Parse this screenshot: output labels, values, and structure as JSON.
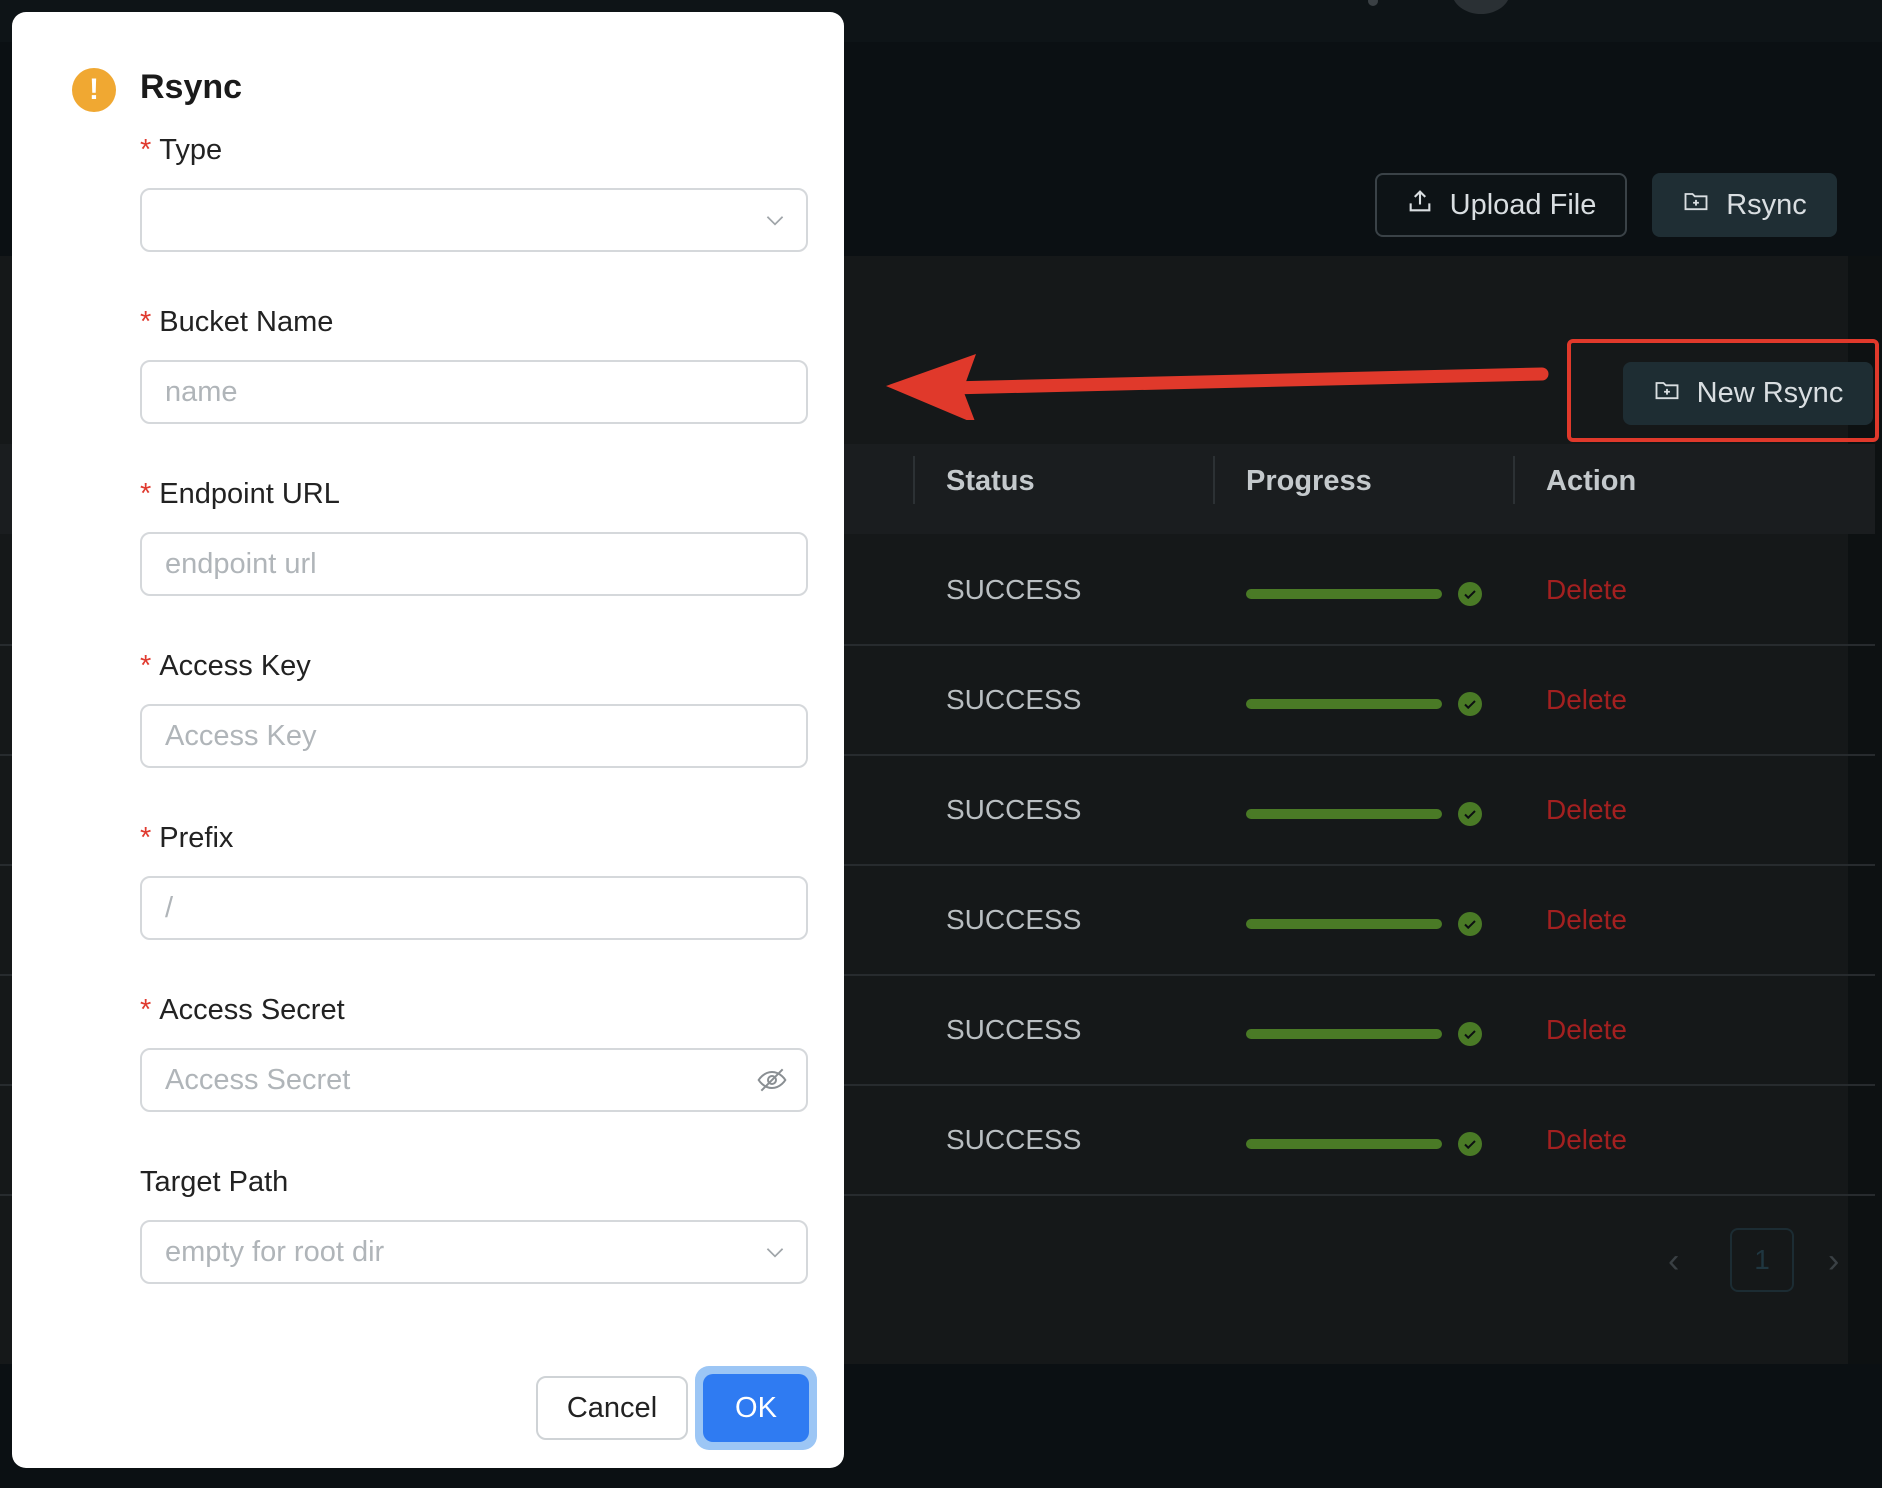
{
  "toolbar": {
    "upload_label": "Upload File",
    "rsync_label": "Rsync",
    "new_rsync_label": "New Rsync"
  },
  "table": {
    "columns": [
      "Status",
      "Progress",
      "Action"
    ],
    "rows": [
      {
        "status": "SUCCESS",
        "progress": 1.0,
        "action": "Delete"
      },
      {
        "status": "SUCCESS",
        "progress": 1.0,
        "action": "Delete"
      },
      {
        "status": "SUCCESS",
        "progress": 1.0,
        "action": "Delete"
      },
      {
        "status": "SUCCESS",
        "progress": 1.0,
        "action": "Delete"
      },
      {
        "status": "SUCCESS",
        "progress": 1.0,
        "action": "Delete"
      },
      {
        "status": "SUCCESS",
        "progress": 1.0,
        "action": "Delete"
      }
    ]
  },
  "pagination": {
    "current_page": "1",
    "prev_icon": "chevron-left-icon",
    "next_icon": "chevron-right-icon"
  },
  "modal": {
    "title": "Rsync",
    "icon": "warning-icon",
    "required_mark": "*",
    "fields": {
      "type": {
        "label": "Type",
        "placeholder": "",
        "required": true
      },
      "bucket_name": {
        "label": "Bucket Name",
        "placeholder": "name",
        "required": true
      },
      "endpoint_url": {
        "label": "Endpoint URL",
        "placeholder": "endpoint url",
        "required": true
      },
      "access_key": {
        "label": "Access Key",
        "placeholder": "Access Key",
        "required": true
      },
      "prefix": {
        "label": "Prefix",
        "placeholder": "/",
        "required": true
      },
      "access_secret": {
        "label": "Access Secret",
        "placeholder": "Access Secret",
        "required": true
      },
      "target_path": {
        "label": "Target Path",
        "placeholder": "empty for root dir",
        "required": false
      }
    },
    "cancel_label": "Cancel",
    "ok_label": "OK"
  },
  "colors": {
    "annotation": "#e0392b",
    "warning": "#f0a832",
    "primary": "#2f7bf2",
    "progress": "#4a7a26",
    "danger": "#a32020"
  }
}
